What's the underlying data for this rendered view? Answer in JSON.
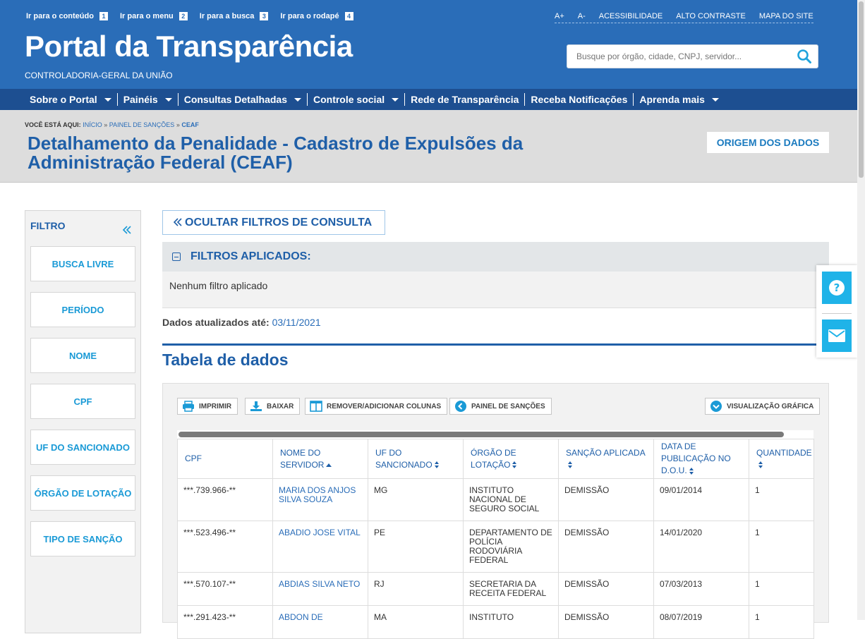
{
  "header": {
    "skip_links": [
      {
        "label": "Ir para o conteúdo",
        "key": "1"
      },
      {
        "label": "Ir para o menu",
        "key": "2"
      },
      {
        "label": "Ir para a busca",
        "key": "3"
      },
      {
        "label": "Ir para o rodapé",
        "key": "4"
      }
    ],
    "top_links": [
      "A+",
      "A-",
      "ACESSIBILIDADE",
      "ALTO CONTRASTE",
      "MAPA DO SITE"
    ],
    "brand": "Portal da Transparência",
    "subtitle": "CONTROLADORIA-GERAL DA UNIÃO",
    "search_placeholder": "Busque por órgão, cidade, CNPJ, servidor..."
  },
  "nav": [
    {
      "label": "Sobre o Portal",
      "dropdown": true
    },
    {
      "label": "Painéis",
      "dropdown": true
    },
    {
      "label": "Consultas Detalhadas",
      "dropdown": true
    },
    {
      "label": "Controle social",
      "dropdown": true
    },
    {
      "label": "Rede de Transparência",
      "dropdown": false
    },
    {
      "label": "Receba Notificações",
      "dropdown": false
    },
    {
      "label": "Aprenda mais",
      "dropdown": true
    }
  ],
  "breadcrumb": {
    "prefix": "VOCÊ ESTÁ AQUI:",
    "items": [
      "INÍCIO",
      "PAINEL DE SANÇÕES"
    ],
    "current": "CEAF",
    "sep": "»"
  },
  "page_title": "Detalhamento da Penalidade - Cadastro de Expulsões da Administração Federal (CEAF)",
  "origem_button": "ORIGEM DOS DADOS",
  "sidebar": {
    "title": "FILTRO",
    "filters": [
      "BUSCA LIVRE",
      "PERÍODO",
      "NOME",
      "CPF",
      "UF DO SANCIONADO",
      "ÓRGÃO DE LOTAÇÃO",
      "TIPO DE SANÇÃO"
    ]
  },
  "main": {
    "hide_filters": "OCULTAR FILTROS DE CONSULTA",
    "applied_title": "FILTROS APLICADOS:",
    "applied_body": "Nenhum filtro aplicado",
    "updated_label": "Dados atualizados até:",
    "updated_date": "03/11/2021",
    "table_title": "Tabela de dados"
  },
  "toolbar": {
    "print": "IMPRIMIR",
    "download": "BAIXAR",
    "columns": "REMOVER/ADICIONAR COLUNAS",
    "panel": "PAINEL DE SANÇÕES",
    "chart": "VISUALIZAÇÃO GRÁFICA"
  },
  "table": {
    "headers": [
      "CPF",
      "NOME DO SERVIDOR",
      "UF DO SANCIONADO",
      "ÓRGÃO DE LOTAÇÃO",
      "SANÇÃO APLICADA",
      "DATA DE PUBLICAÇÃO NO D.O.U.",
      "QUANTIDADE"
    ],
    "rows": [
      [
        "***.739.966-**",
        "MARIA DOS ANJOS SILVA SOUZA",
        "MG",
        "INSTITUTO NACIONAL DE SEGURO SOCIAL",
        "DEMISSÃO",
        "09/01/2014",
        "1"
      ],
      [
        "***.523.496-**",
        "ABADIO JOSE VITAL",
        "PE",
        "DEPARTAMENTO DE POLÍCIA RODOVIÁRIA FEDERAL",
        "DEMISSÃO",
        "14/01/2020",
        "1"
      ],
      [
        "***.570.107-**",
        "ABDIAS SILVA NETO",
        "RJ",
        "SECRETARIA DA RECEITA FEDERAL",
        "DEMISSÃO",
        "07/03/2013",
        "1"
      ],
      [
        "***.291.423-**",
        "ABDON DE",
        "MA",
        "INSTITUTO",
        "DEMISSÃO",
        "08/07/2019",
        "1"
      ]
    ]
  },
  "icons": {
    "help": "question-icon",
    "mail": "envelope-icon",
    "search": "search-icon"
  },
  "colors": {
    "header_blue": "#2a6db8",
    "nav_blue": "#1d4f91",
    "accent_cyan": "#1fb3e8"
  }
}
